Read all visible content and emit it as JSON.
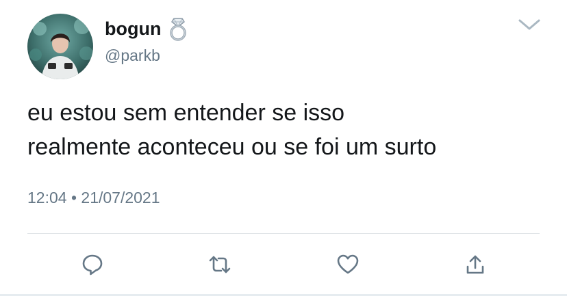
{
  "user": {
    "display_name": "bogun",
    "handle": "@parkb",
    "name_emoji_icon": "ring-icon",
    "avatar_icon": "avatar-photo"
  },
  "tweet": {
    "text": "eu estou sem entender se isso\nrealmente aconteceu ou se foi um surto",
    "time": "12:04",
    "separator": "•",
    "date": "21/07/2021"
  },
  "actions": [
    {
      "name": "reply",
      "icon": "reply-icon"
    },
    {
      "name": "retweet",
      "icon": "retweet-icon"
    },
    {
      "name": "like",
      "icon": "heart-icon"
    },
    {
      "name": "share",
      "icon": "share-icon"
    }
  ],
  "menu": {
    "icon": "chevron-down-icon"
  },
  "colors": {
    "text_primary": "#14171a",
    "text_secondary": "#657786",
    "icon": "#657786",
    "divider": "#dfe3e6"
  }
}
